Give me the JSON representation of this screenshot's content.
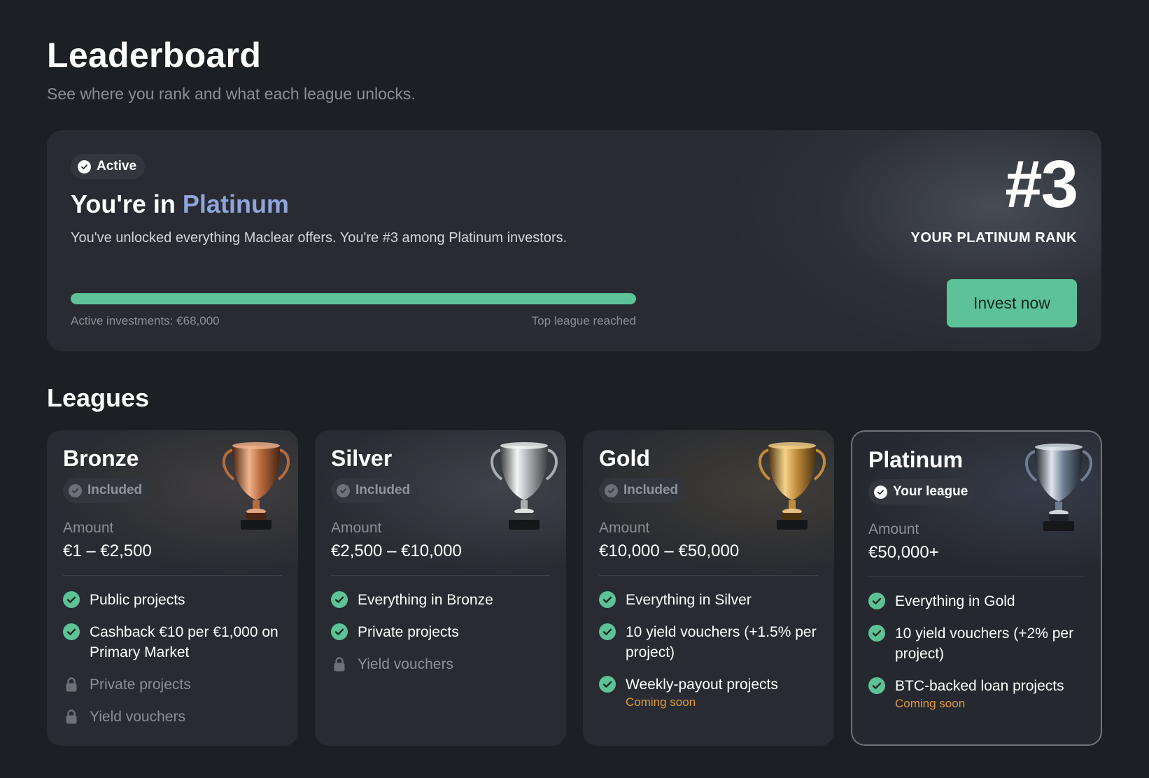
{
  "header": {
    "title": "Leaderboard",
    "subtitle": "See where you rank and what each league unlocks."
  },
  "hero": {
    "status": "Active",
    "heading_prefix": "You're in",
    "heading_league": "Platinum",
    "description": "You've unlocked everything Maclear offers. You're #3 among Platinum investors.",
    "progress_percent": 100,
    "progress_left": "Active investments: €68,000",
    "progress_right": "Top league reached",
    "rank": "#3",
    "rank_label": "YOUR PLATINUM RANK",
    "cta": "Invest now"
  },
  "leagues_title": "Leagues",
  "leagues": [
    {
      "name": "Bronze",
      "chip": "Included",
      "amount_label": "Amount",
      "amount": "€1 – €2,500",
      "features": [
        {
          "text": "Public projects",
          "locked": false
        },
        {
          "text": "Cashback €10 per €1,000 on Primary Market",
          "locked": false
        },
        {
          "text": "Private projects",
          "locked": true
        },
        {
          "text": "Yield vouchers",
          "locked": true
        }
      ]
    },
    {
      "name": "Silver",
      "chip": "Included",
      "amount_label": "Amount",
      "amount": "€2,500 – €10,000",
      "features": [
        {
          "text": "Everything in Bronze",
          "locked": false
        },
        {
          "text": "Private projects",
          "locked": false
        },
        {
          "text": "Yield vouchers",
          "locked": true
        }
      ]
    },
    {
      "name": "Gold",
      "chip": "Included",
      "amount_label": "Amount",
      "amount": "€10,000 – €50,000",
      "features": [
        {
          "text": "Everything in Silver",
          "locked": false
        },
        {
          "text": "10 yield vouchers (+1.5% per project)",
          "locked": false
        },
        {
          "text": "Weekly-payout projects",
          "locked": false,
          "note": "Coming soon"
        }
      ]
    },
    {
      "name": "Platinum",
      "chip": "Your league",
      "amount_label": "Amount",
      "amount": "€50,000+",
      "features": [
        {
          "text": "Everything in Gold",
          "locked": false
        },
        {
          "text": "10 yield vouchers (+2% per project)",
          "locked": false
        },
        {
          "text": "BTC-backed loan projects",
          "locked": false,
          "note": "Coming soon"
        }
      ]
    }
  ],
  "colors": {
    "background": "#1c1f24",
    "card": "#282b31",
    "accent_green": "#5dc297",
    "accent_blue": "#8fa5db",
    "coming_soon": "#e09a3a",
    "muted_text": "#8a8f96"
  }
}
